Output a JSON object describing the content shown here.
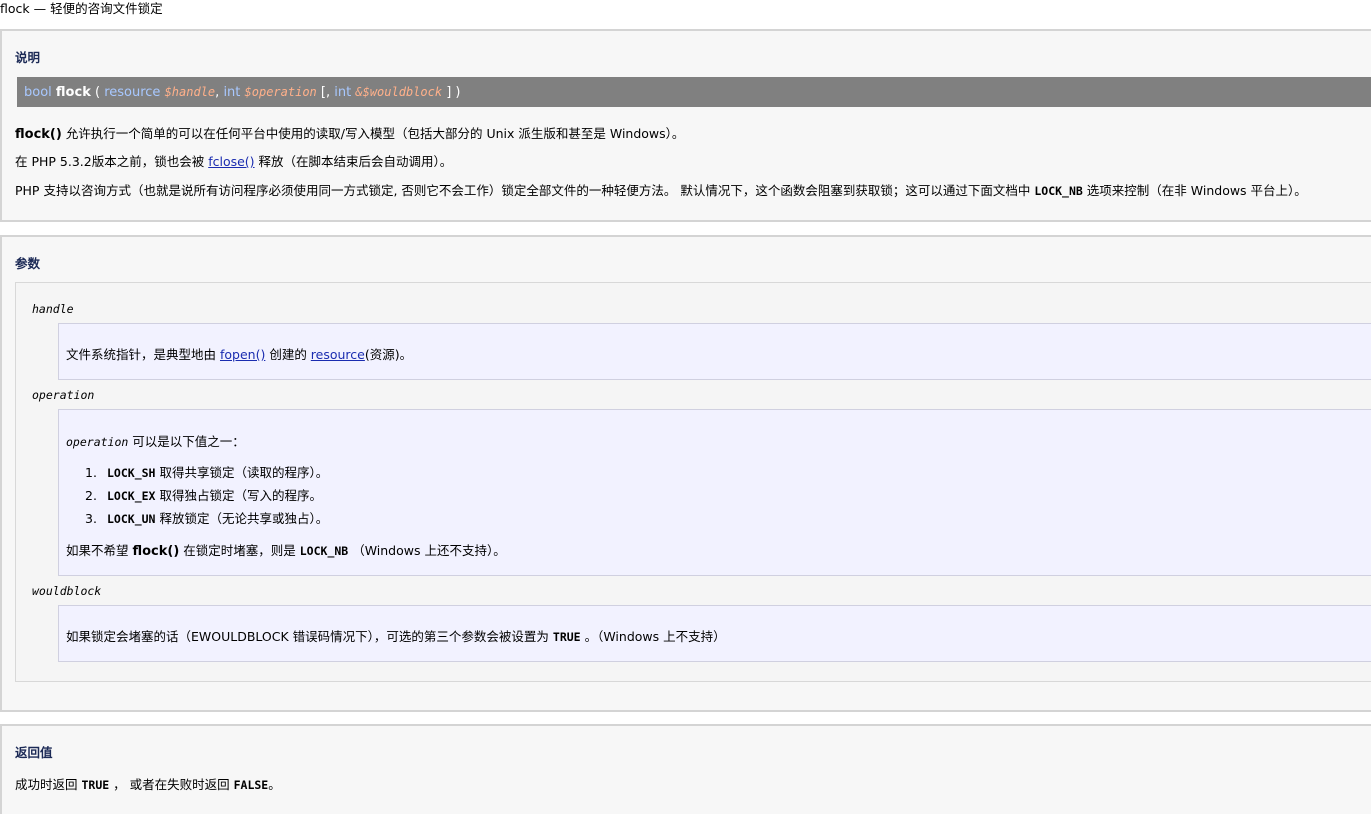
{
  "page_title": "flock — 轻便的咨询文件锁定",
  "description": {
    "heading": "说明",
    "synopsis": {
      "return_type": "bool",
      "name": "flock",
      "open": "(",
      "p1_type": "resource",
      "p1_var": "$handle",
      "sep1": ",",
      "p2_type": "int",
      "p2_var": "$operation",
      "opt_open": "[,",
      "p3_type": "int",
      "p3_var": "&$wouldblock",
      "close": "] )"
    },
    "line1": {
      "fn": "flock()",
      "text": " 允许执行一个简单的可以在任何平台中使用的读取/写入模型（包括大部分的 Unix 派生版和甚至是 Windows）。"
    },
    "line2": {
      "pre": "在 PHP 5.3.2版本之前，锁也会被 ",
      "link": "fclose()",
      "post": " 释放（在脚本结束后会自动调用）。"
    },
    "line3": {
      "pre": "PHP 支持以咨询方式（也就是说所有访问程序必须使用同一方式锁定, 否则它不会工作）锁定全部文件的一种轻便方法。 默认情况下，这个函数会阻塞到获取锁；这可以通过下面文档中 ",
      "code": "LOCK_NB",
      "post": " 选项来控制（在非 Windows 平台上）。"
    }
  },
  "parameters": {
    "heading": "参数",
    "handle": {
      "term": "handle",
      "pre": "文件系统指针，是典型地由 ",
      "link1": "fopen()",
      "mid": " 创建的 ",
      "link2": "resource",
      "post": "(资源)。"
    },
    "operation": {
      "term": "operation",
      "intro_code": "operation",
      "intro_text": " 可以是以下值之一：",
      "items": [
        {
          "num": "1.",
          "code": "LOCK_SH",
          "text": " 取得共享锁定（读取的程序）。"
        },
        {
          "num": "2.",
          "code": "LOCK_EX",
          "text": " 取得独占锁定（写入的程序。"
        },
        {
          "num": "3.",
          "code": "LOCK_UN",
          "text": " 释放锁定（无论共享或独占）。"
        }
      ],
      "footer_pre": "如果不希望 ",
      "footer_fn": "flock()",
      "footer_mid": " 在锁定时堵塞，则是 ",
      "footer_code": "LOCK_NB",
      "footer_post": " （Windows 上还不支持）。"
    },
    "wouldblock": {
      "term": "wouldblock",
      "pre": "如果锁定会堵塞的话（EWOULDBLOCK 错误码情况下），可选的第三个参数会被设置为 ",
      "code": "TRUE",
      "post": " 。（Windows 上不支持）"
    }
  },
  "return_values": {
    "heading": "返回值",
    "pre": "成功时返回 ",
    "code1": "TRUE",
    "mid": " ， 或者在失败时返回 ",
    "code2": "FALSE",
    "post": "。"
  }
}
